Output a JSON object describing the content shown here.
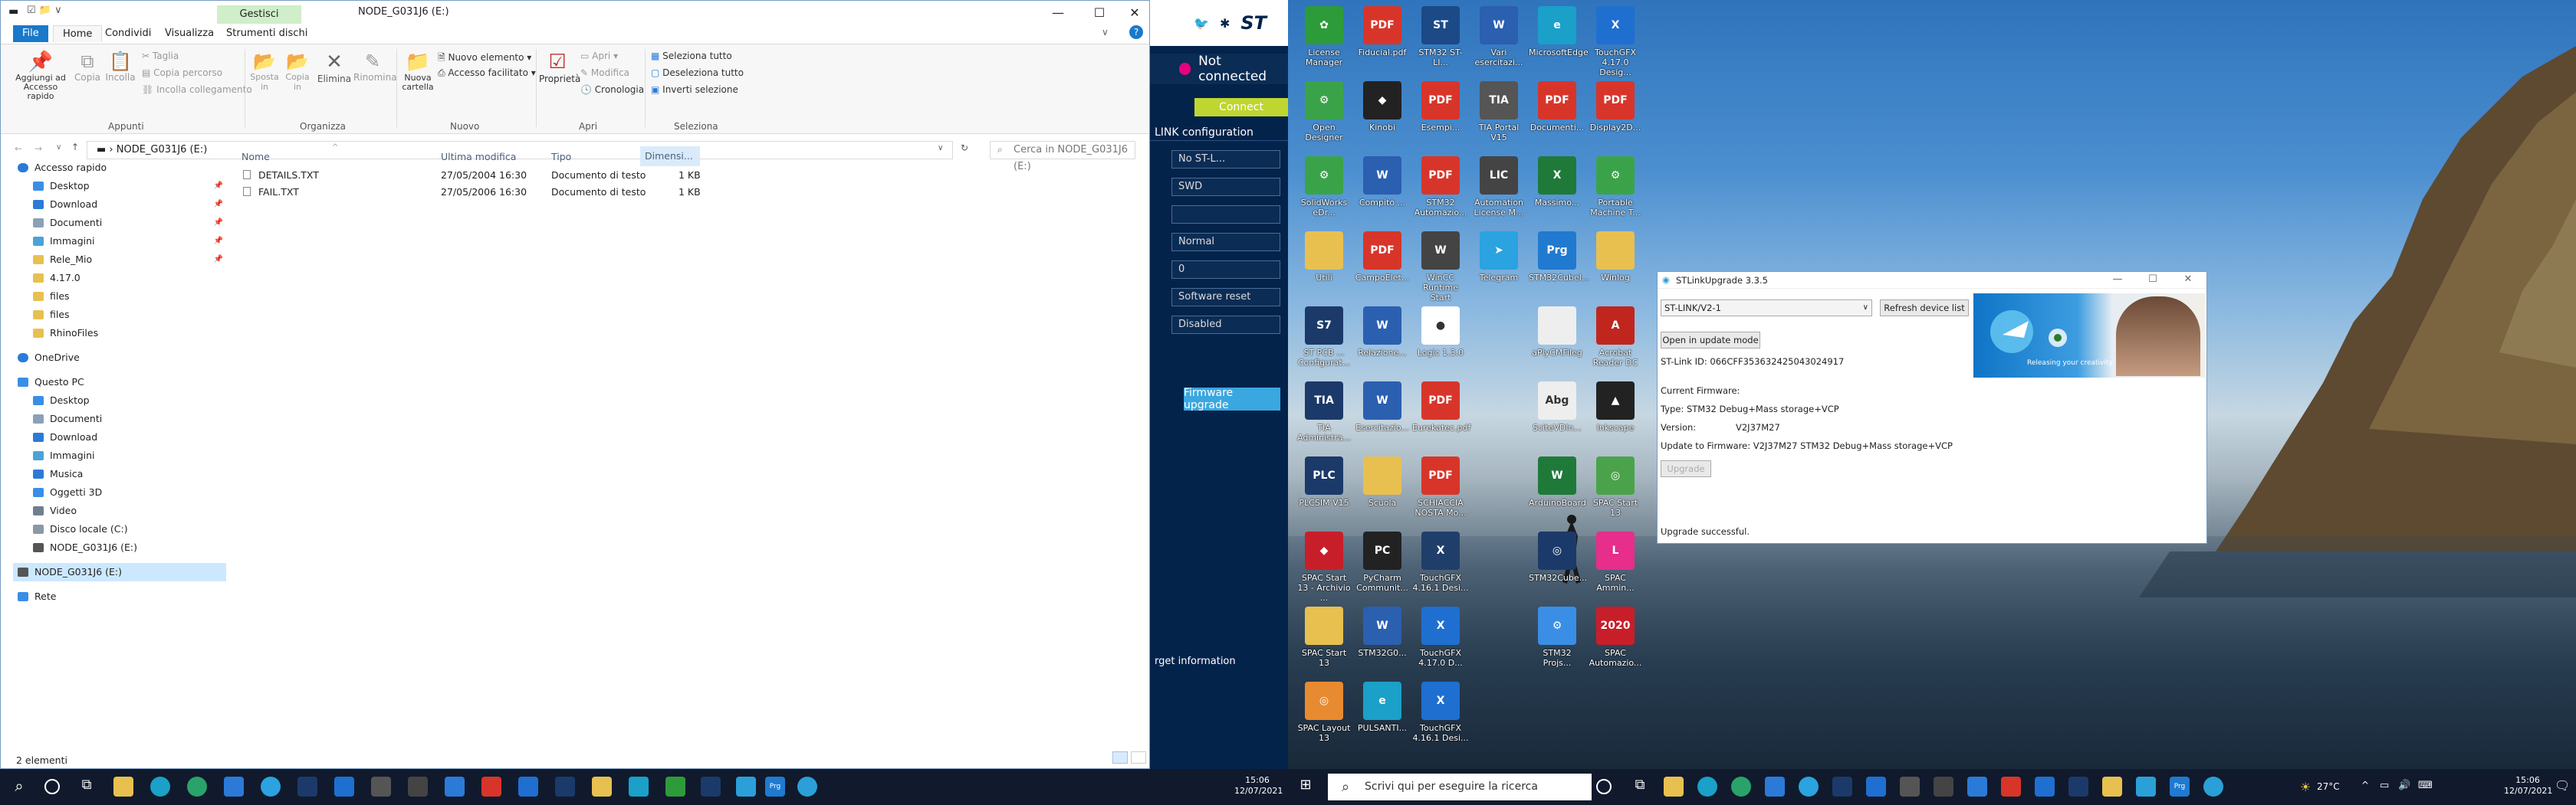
{
  "explorer": {
    "title": "NODE_G031J6 (E:)",
    "manage_tab": "Gestisci",
    "tabs": [
      "File",
      "Home",
      "Condividi",
      "Visualizza",
      "Strumenti dischi"
    ],
    "ribbon": {
      "pin_label": "Aggiungi ad Accesso rapido",
      "copy": "Copia",
      "paste": "Incolla",
      "cut": "Taglia",
      "copy_path": "Copia percorso",
      "paste_link": "Incolla collegamento",
      "group_clipboard": "Appunti",
      "move_to": "Sposta in",
      "copy_to": "Copia in",
      "delete": "Elimina",
      "rename": "Rinomina",
      "group_organize": "Organizza",
      "new_folder": "Nuova cartella",
      "new_item": "Nuovo elemento",
      "easy_access": "Accesso facilitato",
      "group_new": "Nuovo",
      "properties": "Proprietà",
      "open": "Apri",
      "edit": "Modifica",
      "history": "Cronologia",
      "group_open": "Apri",
      "select_all": "Seleziona tutto",
      "select_none": "Deseleziona tutto",
      "invert": "Inverti selezione",
      "group_select": "Seleziona"
    },
    "address": "NODE_G031J6 (E:)",
    "search_placeholder": "Cerca in NODE_G031J6 (E:)",
    "columns": [
      "Nome",
      "Ultima modifica",
      "Tipo",
      "Dimensi..."
    ],
    "files": [
      {
        "name": "DETAILS.TXT",
        "modified": "27/05/2004 16:30",
        "type": "Documento di testo",
        "size": "1 KB"
      },
      {
        "name": "FAIL.TXT",
        "modified": "27/05/2006 16:30",
        "type": "Documento di testo",
        "size": "1 KB"
      }
    ],
    "nav": [
      {
        "label": "Accesso rapido",
        "level": 0,
        "icon": "star-icon",
        "color": "#2b7ad8"
      },
      {
        "label": "Desktop",
        "level": 1,
        "icon": "desktop-icon",
        "color": "#3a8ee6",
        "pin": true
      },
      {
        "label": "Download",
        "level": 1,
        "icon": "download-icon",
        "color": "#2b7ad8",
        "pin": true
      },
      {
        "label": "Documenti",
        "level": 1,
        "icon": "documents-icon",
        "color": "#8aa1b8",
        "pin": true
      },
      {
        "label": "Immagini",
        "level": 1,
        "icon": "pictures-icon",
        "color": "#4aa3d8",
        "pin": true
      },
      {
        "label": "Rele_Mio",
        "level": 1,
        "icon": "folder-icon",
        "color": "#e8c050",
        "pin": true
      },
      {
        "label": "4.17.0",
        "level": 1,
        "icon": "folder-icon",
        "color": "#e8c050"
      },
      {
        "label": "files",
        "level": 1,
        "icon": "folder-icon",
        "color": "#e8c050"
      },
      {
        "label": "files",
        "level": 1,
        "icon": "folder-icon",
        "color": "#e8c050"
      },
      {
        "label": "RhinoFiles",
        "level": 1,
        "icon": "folder-icon",
        "color": "#e8c050"
      },
      {
        "label": "OneDrive",
        "level": 0,
        "icon": "cloud-icon",
        "color": "#2b7ad8"
      },
      {
        "label": "Questo PC",
        "level": 0,
        "icon": "pc-icon",
        "color": "#3a8ee6"
      },
      {
        "label": "Desktop",
        "level": 1,
        "icon": "desktop-icon",
        "color": "#3a8ee6"
      },
      {
        "label": "Documenti",
        "level": 1,
        "icon": "documents-icon",
        "color": "#8aa1b8"
      },
      {
        "label": "Download",
        "level": 1,
        "icon": "download-icon",
        "color": "#2b7ad8"
      },
      {
        "label": "Immagini",
        "level": 1,
        "icon": "pictures-icon",
        "color": "#4aa3d8"
      },
      {
        "label": "Musica",
        "level": 1,
        "icon": "music-icon",
        "color": "#2b7ad8"
      },
      {
        "label": "Oggetti 3D",
        "level": 1,
        "icon": "cube-icon",
        "color": "#3a8ee6"
      },
      {
        "label": "Video",
        "level": 1,
        "icon": "video-icon",
        "color": "#6f7f90"
      },
      {
        "label": "Disco locale (C:)",
        "level": 1,
        "icon": "drive-icon",
        "color": "#8b98a6"
      },
      {
        "label": "NODE_G031J6 (E:)",
        "level": 1,
        "icon": "drive-icon",
        "color": "#555"
      },
      {
        "label": "NODE_G031J6 (E:)",
        "level": 0,
        "icon": "drive-icon",
        "color": "#555",
        "selected": true
      },
      {
        "label": "Rete",
        "level": 0,
        "icon": "network-icon",
        "color": "#3a8ee6"
      }
    ],
    "status": "2 elementi"
  },
  "stm32prog": {
    "status": "Not connected",
    "connect": "Connect",
    "config_title": "LINK configuration",
    "fields": [
      "No ST-L...",
      "SWD",
      "",
      "Normal",
      "0",
      "Software reset",
      "Disabled"
    ],
    "fw_upgrade": "Firmware upgrade",
    "target_info": "rget information"
  },
  "desktop_icons": [
    {
      "label": "License Manager",
      "color": "#2d9b3a",
      "glyph": "✿"
    },
    {
      "label": "Fiducial.pdf",
      "color": "#d8352a",
      "glyph": "PDF"
    },
    {
      "label": "STM32 ST-LI...",
      "color": "#1b4a86",
      "glyph": "ST"
    },
    {
      "label": "Vari esercitazi...",
      "color": "#2b5fb0",
      "glyph": "W"
    },
    {
      "label": "MicrosoftEdge",
      "color": "#1aa0c9",
      "glyph": "e"
    },
    {
      "label": "TouchGFX 4.17.0 Desig...",
      "color": "#1f6fd1",
      "glyph": "X"
    },
    {
      "label": "Open Designer",
      "color": "#3aa34a",
      "glyph": "⚙"
    },
    {
      "label": "Kinobi",
      "color": "#222",
      "glyph": "◆"
    },
    {
      "label": "Esempi...",
      "color": "#d8352a",
      "glyph": "PDF"
    },
    {
      "label": "TIA Portal V15",
      "color": "#555",
      "glyph": "TIA"
    },
    {
      "label": "Documenti...",
      "color": "#d8352a",
      "glyph": "PDF"
    },
    {
      "label": "Display2D...",
      "color": "#d8352a",
      "glyph": "PDF"
    },
    {
      "label": "SolidWorks eDr...",
      "color": "#3aa34a",
      "glyph": "⚙"
    },
    {
      "label": "Compito ...",
      "color": "#2b5fb0",
      "glyph": "W"
    },
    {
      "label": "STM32 Automazio...",
      "color": "#d8352a",
      "glyph": "PDF"
    },
    {
      "label": "Automation License M...",
      "color": "#444",
      "glyph": "LIC"
    },
    {
      "label": "Massimo...",
      "color": "#1f7a3a",
      "glyph": "X"
    },
    {
      "label": "Portable Machine T...",
      "color": "#3aa34a",
      "glyph": "⚙"
    },
    {
      "label": "Utili",
      "color": "#e8c050",
      "glyph": ""
    },
    {
      "label": "CampoElet...",
      "color": "#d8352a",
      "glyph": "PDF"
    },
    {
      "label": "WinCC Runtime Start",
      "color": "#444",
      "glyph": "W"
    },
    {
      "label": "Telegram",
      "color": "#2aa3e0",
      "glyph": "➤"
    },
    {
      "label": "STM32CubeI...",
      "color": "#1f7ad0",
      "glyph": "Prg"
    },
    {
      "label": "Winlog",
      "color": "#e8c050",
      "glyph": ""
    },
    {
      "label": "ST PCB ... Configurat...",
      "color": "#1b3a6a",
      "glyph": "S7"
    },
    {
      "label": "Relazione...",
      "color": "#2b5fb0",
      "glyph": "W"
    },
    {
      "label": "Logic 1.3.0",
      "color": "#fff",
      "glyph": "●"
    },
    {
      "label": "",
      "color": "transparent",
      "glyph": ""
    },
    {
      "label": "aPlyCMFileg",
      "color": "#eee",
      "glyph": ""
    },
    {
      "label": "Acrobat Reader DC",
      "color": "#c0261e",
      "glyph": "A"
    },
    {
      "label": "TIA Administra...",
      "color": "#1b3a6a",
      "glyph": "TIA"
    },
    {
      "label": "Esercitazio...",
      "color": "#2b5fb0",
      "glyph": "W"
    },
    {
      "label": "Eurekatec.pdf",
      "color": "#d8352a",
      "glyph": "PDF"
    },
    {
      "label": "",
      "color": "transparent",
      "glyph": ""
    },
    {
      "label": "SciteVDIn...",
      "color": "#eee",
      "glyph": "Abg"
    },
    {
      "label": "Inkscape",
      "color": "#222",
      "glyph": "▲"
    },
    {
      "label": "PLCSIM V15",
      "color": "#1b3a6a",
      "glyph": "PLC"
    },
    {
      "label": "Scuola",
      "color": "#e8c050",
      "glyph": ""
    },
    {
      "label": "SCHIACCIA NOSTA Mo...",
      "color": "#d8352a",
      "glyph": "PDF"
    },
    {
      "label": "",
      "color": "transparent",
      "glyph": ""
    },
    {
      "label": "ArduinoBoard",
      "color": "#1f7a3a",
      "glyph": "W"
    },
    {
      "label": "SPAC Start 13",
      "color": "#4aa34a",
      "glyph": "◎"
    },
    {
      "label": "SPAC Start 13 - Archivio ...",
      "color": "#c81e2a",
      "glyph": "◆"
    },
    {
      "label": "PyCharm Communit...",
      "color": "#222",
      "glyph": "PC"
    },
    {
      "label": "TouchGFX 4.16.1 Desi...",
      "color": "#1f3f6a",
      "glyph": "X"
    },
    {
      "label": "",
      "color": "transparent",
      "glyph": ""
    },
    {
      "label": "STM32Cube...",
      "color": "#1b3a6a",
      "glyph": "◎"
    },
    {
      "label": "SPAC Ammin...",
      "color": "#e62e8a",
      "glyph": "L"
    },
    {
      "label": "SPAC Start 13",
      "color": "#e8c050",
      "glyph": ""
    },
    {
      "label": "STM32G0...",
      "color": "#2b5fb0",
      "glyph": "W"
    },
    {
      "label": "TouchGFX 4.17.0 D...",
      "color": "#1f6fd1",
      "glyph": "X"
    },
    {
      "label": "",
      "color": "transparent",
      "glyph": ""
    },
    {
      "label": "STM32 Projs...",
      "color": "#3a8ee6",
      "glyph": "⚙"
    },
    {
      "label": "SPAC Automazio...",
      "color": "#c81e2a",
      "glyph": "2020"
    },
    {
      "label": "SPAC Layout 13",
      "color": "#e88a30",
      "glyph": "◎"
    },
    {
      "label": "PULSANTI...",
      "color": "#1aa0c9",
      "glyph": "e"
    },
    {
      "label": "TouchGFX 4.16.1 Desi...",
      "color": "#1f6fd1",
      "glyph": "X"
    }
  ],
  "stlink": {
    "title": "STLinkUpgrade 3.3.5",
    "device": "ST-LINK/V2-1",
    "refresh": "Refresh device list",
    "open_update": "Open in update mode",
    "stlink_id": "ST-Link ID: 066CFF353632425043024917",
    "current_fw": "Current Firmware:",
    "type": "Type: STM32 Debug+Mass storage+VCP",
    "version_label": "Version:",
    "version": "V2J37M27",
    "update_to": "Update to Firmware: V2J37M27 STM32 Debug+Mass storage+VCP",
    "upgrade": "Upgrade",
    "result": "Upgrade successful.",
    "banner_caption": "Releasing your creativity"
  },
  "taskbar_left": {
    "time": "15:06",
    "date": "12/07/2021"
  },
  "taskbar_right": {
    "search": "Scrivi qui per eseguire la ricerca",
    "weather": "27°C",
    "time": "15:06",
    "date": "12/07/2021"
  }
}
